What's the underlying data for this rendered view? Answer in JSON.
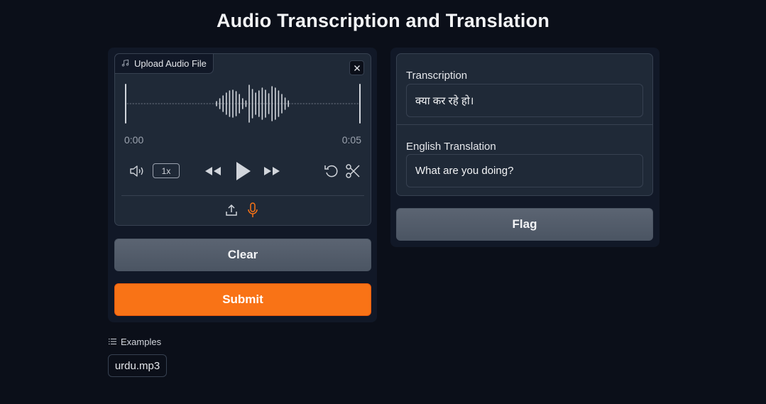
{
  "app": {
    "title": "Audio Transcription and Translation"
  },
  "audio_input": {
    "label": "Upload Audio File",
    "label_icon": "music-note-icon",
    "time_start": "0:00",
    "time_end": "0:05",
    "playback_speed": "1x",
    "icons": {
      "close": "close-icon",
      "volume": "volume-icon",
      "rewind": "rewind-icon",
      "play": "play-icon",
      "fast_forward": "fast-forward-icon",
      "undo": "undo-icon",
      "trim": "scissors-icon",
      "upload": "upload-icon",
      "microphone": "microphone-icon"
    }
  },
  "buttons": {
    "clear": "Clear",
    "submit": "Submit",
    "flag": "Flag"
  },
  "outputs": {
    "transcription_label": "Transcription",
    "transcription_value": "क्या कर रहे हो।",
    "translation_label": "English Translation",
    "translation_value": "What are you doing?"
  },
  "examples": {
    "label": "Examples",
    "items": [
      "urdu.mp3"
    ]
  },
  "colors": {
    "background": "#0b0f19",
    "panel": "#111827",
    "block": "#1f2937",
    "accent": "#f97316",
    "mic_active": "#f97316"
  }
}
